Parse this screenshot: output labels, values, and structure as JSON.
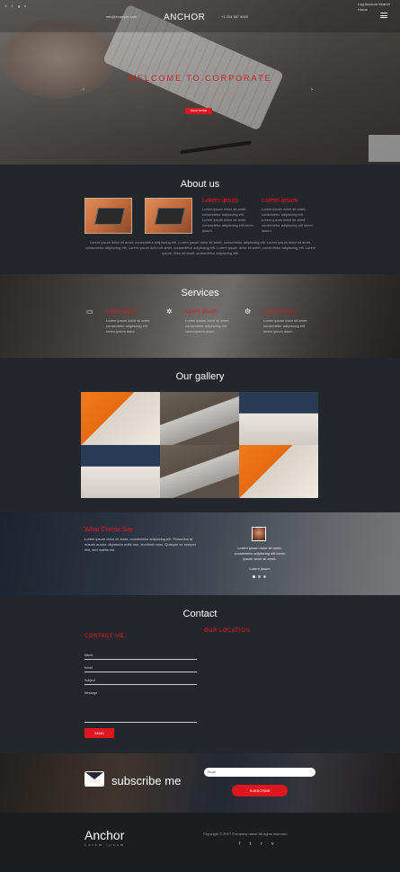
{
  "header": {
    "social_icons": [
      "facebook-icon",
      "twitter-icon",
      "google-plus-icon",
      "vimeo-icon"
    ],
    "email": "info@example.com",
    "brand": "ANCHOR",
    "phone": "+1 234 567 8900",
    "top_right": "Log Account  Search  Home"
  },
  "hero": {
    "title": "WELCOME TO CORPORATE",
    "button": "READ MORE",
    "prev_arrow": "‹",
    "next_arrow": "›"
  },
  "about": {
    "title": "About us",
    "columns": [
      {
        "heading": "Lorem ipsum",
        "text": "Lorem ipsum dolor sit amet, consectetur adipiscing elit. Lorem ipsum dolor sit amet, consectetur adipiscing elit lorem ipsum."
      },
      {
        "heading": "Lorem ipsum",
        "text": "Lorem ipsum dolor sit amet, consectetur adipiscing elit. Lorem ipsum dolor sit amet, consectetur adipiscing elit lorem ipsum."
      }
    ],
    "paragraph": "Lorem ipsum dolor sit amet, consectetur adipiscing elit. Lorem ipsum dolor sit amet, consectetur adipiscing elit. Lorem ipsum dolor sit amet, consectetur adipiscing elit. Lorem ipsum dolor sit amet, consectetur adipiscing elit. Lorem ipsum dolor sit amet, consectetur adipiscing elit. Lorem ipsum dolor sit amet, consectetur adipiscing elit."
  },
  "services": {
    "title": "Services",
    "items": [
      {
        "icon": "laptop-icon",
        "heading": "Lorem ipsum",
        "text": "Lorem ipsum dolor sit amet, consectetur adipiscing elit lorem ipsum dolor."
      },
      {
        "icon": "gear-icon",
        "heading": "Lorem ipsum",
        "text": "Lorem ipsum dolor sit amet, consectetur adipiscing elit lorem ipsum dolor."
      },
      {
        "icon": "cogs-icon",
        "heading": "Lorem ipsum",
        "text": "Lorem ipsum dolor sit amet, consectetur adipiscing elit lorem ipsum dolor."
      }
    ]
  },
  "gallery": {
    "title": "Our gallery"
  },
  "testimonials": {
    "title": "What Clients Say",
    "text": "Lorem ipsum dolor sit amet, consectetur adipiscing elit. Phasellus at mauris auctor, dignissim nulla non, tincidunt nunc. Quisque ac semper nisl, sed mattis est.",
    "quote": "Lorem ipsum dolor sit amet, consectetur adipiscing elit lorem ipsum dolor sit amet.",
    "author": "Lorem ipsum"
  },
  "contact": {
    "title": "Contact",
    "contact_heading": "CONTACT ME",
    "location_heading": "OUR LOCATION",
    "fields": {
      "name": "Name",
      "email": "Email",
      "subject": "Subject",
      "message": "Message"
    },
    "send": "SEND"
  },
  "subscribe": {
    "text": "subscribe me",
    "placeholder": "Email",
    "button": "SUBSCRIBE"
  },
  "footer": {
    "brand": "Anchor",
    "sub": "Lorem ipsum",
    "copyright": "Copyright © 2017 Company name All rights reserved",
    "social_icons": [
      "facebook-icon",
      "twitter-icon",
      "rss-icon",
      "vimeo-icon"
    ]
  }
}
